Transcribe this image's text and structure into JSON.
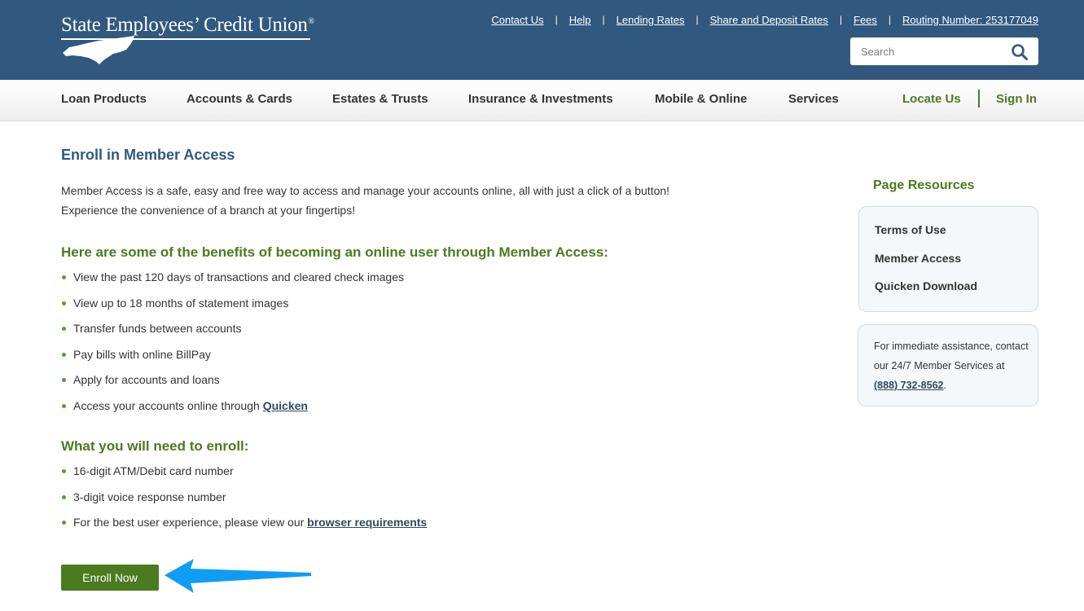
{
  "brand": {
    "name": "State Employees’ Credit Union",
    "reg": "®"
  },
  "utility_links": {
    "contact": "Contact Us",
    "help": "Help",
    "lending": "Lending Rates",
    "share": "Share and Deposit Rates",
    "fees": "Fees",
    "routing": "Routing Number: 253177049",
    "separator": "|"
  },
  "search": {
    "placeholder": "Search",
    "icon": "search-icon"
  },
  "nav": {
    "loan": "Loan Products",
    "accounts": "Accounts & Cards",
    "estates": "Estates & Trusts",
    "insurance": "Insurance & Investments",
    "mobile": "Mobile & Online",
    "services": "Services",
    "locate": "Locate Us",
    "signin": "Sign In"
  },
  "main": {
    "title": "Enroll in Member Access",
    "intro": "Member Access is a safe, easy and free way to access and manage your accounts online, all with just a click of a button! Experience the convenience of a branch at your fingertips!",
    "benefits_heading": "Here are some of the benefits of becoming an online user through Member Access:",
    "benefits": [
      "View the past 120 days of transactions and cleared check images",
      "View up to 18 months of statement images",
      "Transfer funds between accounts",
      "Pay bills with online BillPay",
      "Apply for accounts and loans",
      "Access your accounts online through "
    ],
    "benefits_link": "Quicken",
    "need_heading": "What you will need to enroll:",
    "needs": [
      "16-digit ATM/Debit card number",
      "3-digit voice response number",
      "For the best user experience, please view our "
    ],
    "needs_link": "browser requirements",
    "enroll_label": "Enroll Now"
  },
  "sidebar": {
    "title": "Page Resources",
    "links": [
      "Terms of Use",
      "Member Access",
      "Quicken Download"
    ],
    "help_text": "For immediate assistance, contact our 24/7 Member Services at ",
    "phone": "(888) 732-8562",
    "help_end": "."
  },
  "colors": {
    "header": "#31587e",
    "accent_green": "#4b7b1f",
    "arrow": "#0f9cf5",
    "title_blue": "#31587e"
  }
}
